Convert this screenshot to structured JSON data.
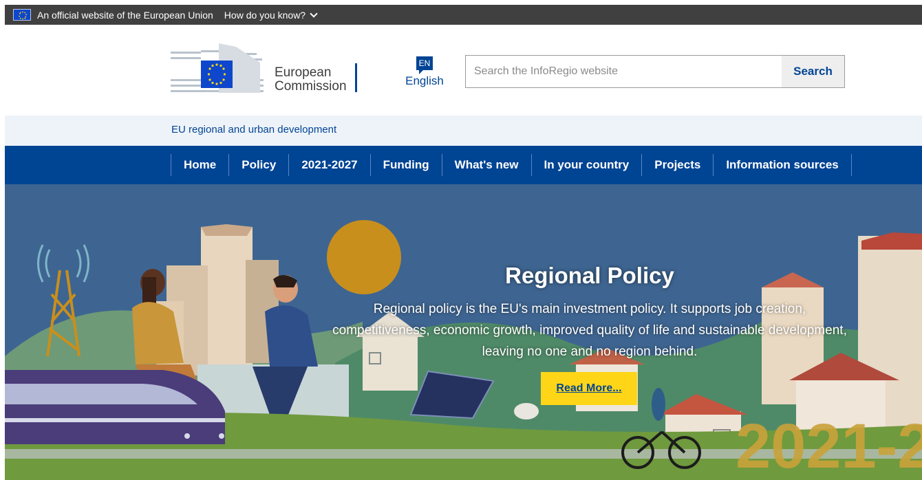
{
  "official_bar": {
    "text": "An official website of the European Union",
    "how_know": "How do you know?"
  },
  "header": {
    "logo_line1": "European",
    "logo_line2": "Commission",
    "lang_code": "EN",
    "lang_label": "English",
    "search_placeholder": "Search the InfoRegio website",
    "search_button": "Search"
  },
  "site_bar": {
    "name": "EU regional and urban development"
  },
  "nav": {
    "items": [
      "Home",
      "Policy",
      "2021-2027",
      "Funding",
      "What's new",
      "In your country",
      "Projects",
      "Information sources"
    ]
  },
  "hero": {
    "title": "Regional Policy",
    "description": "Regional policy is the EU's main investment policy. It supports job creation, competitiveness, economic growth, improved quality of life and sustainable development, leaving no one and no region behind.",
    "button": "Read More...",
    "year_art": "2021-2"
  },
  "colors": {
    "eu_blue": "#004494",
    "flag_blue": "#0e47cb",
    "star_yellow": "#ffd617",
    "official_bar": "#404040",
    "site_bar": "#eef3f9",
    "hero_sky": "#3e6591"
  },
  "icons": {
    "flag": "eu-flag-icon",
    "chevron": "chevron-down-icon",
    "language": "speech-bubble-icon"
  }
}
